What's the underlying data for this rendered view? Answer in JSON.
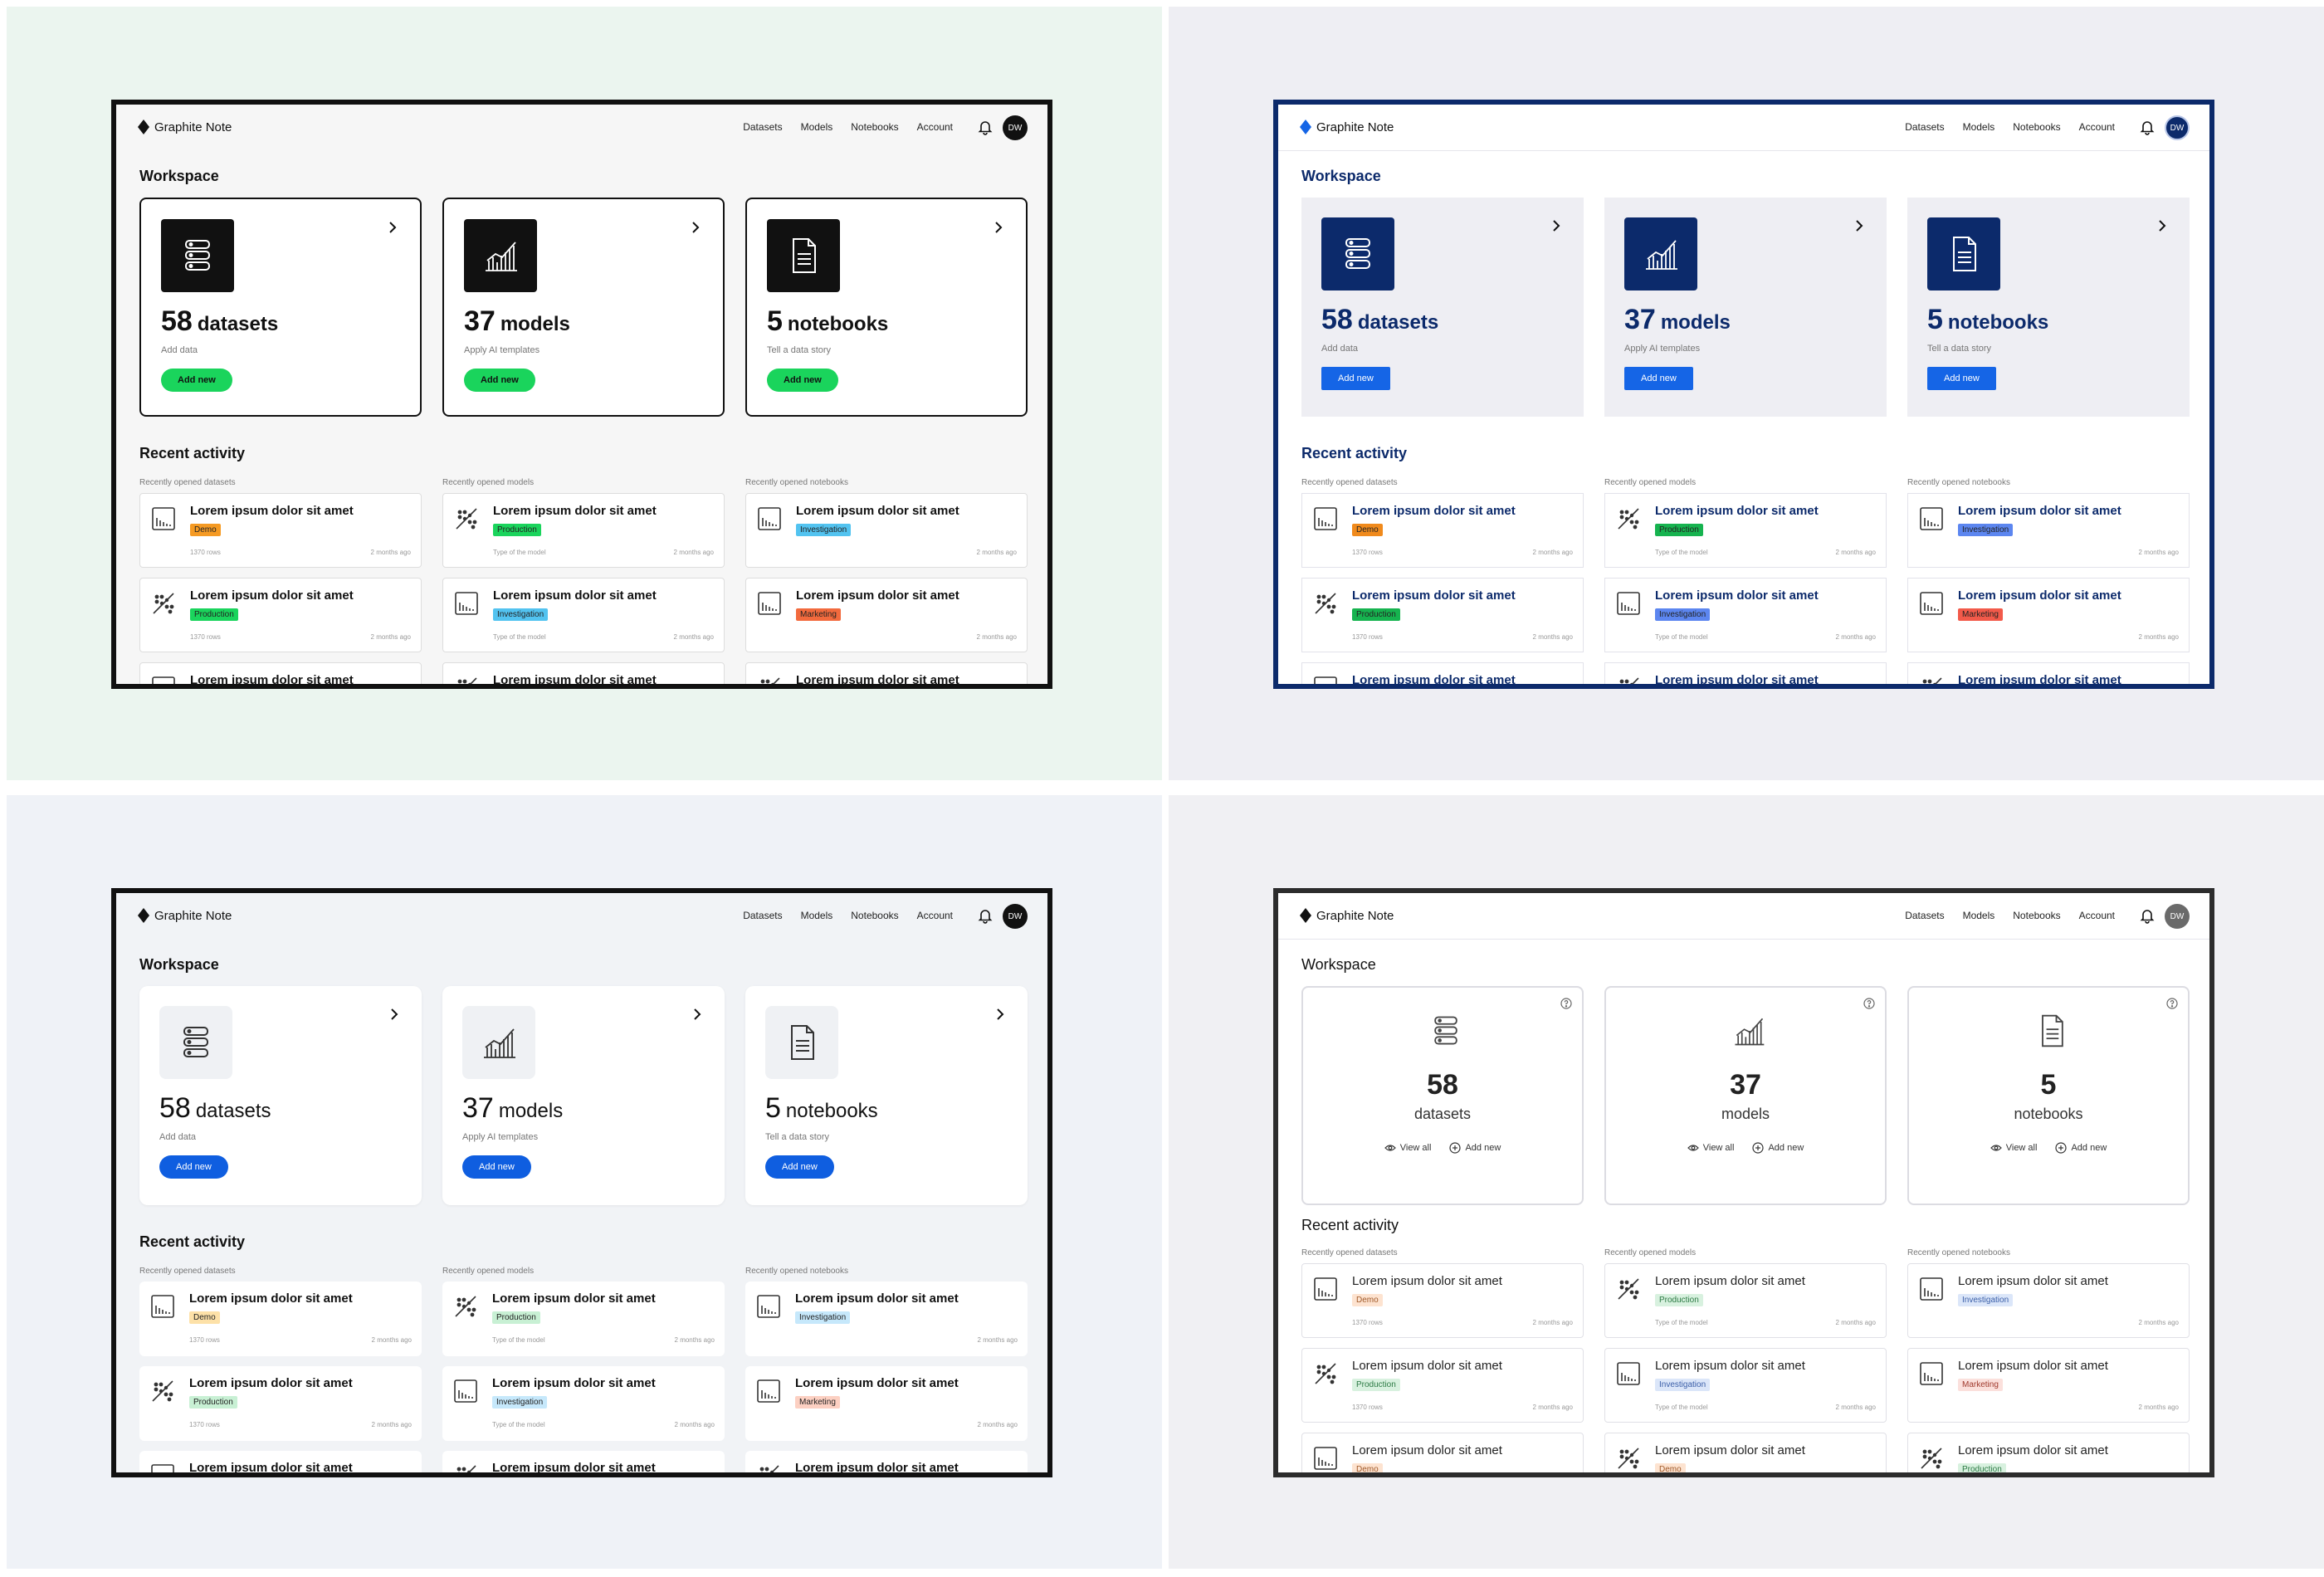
{
  "app": {
    "name": "Graphite Note",
    "avatar": "DW"
  },
  "nav": [
    "Datasets",
    "Models",
    "Notebooks",
    "Account"
  ],
  "workspace": {
    "title": "Workspace",
    "cards": [
      {
        "num": "58",
        "label": "datasets",
        "sub": "Add data",
        "btn": "Add new",
        "icon": "database-icon"
      },
      {
        "num": "37",
        "label": "models",
        "sub": "Apply AI templates",
        "btn": "Add new",
        "icon": "chart-icon"
      },
      {
        "num": "5",
        "label": "notebooks",
        "sub": "Tell a data story",
        "btn": "Add new",
        "icon": "document-icon"
      }
    ],
    "view_all": "View all",
    "add_new": "Add new"
  },
  "recent": {
    "title": "Recent activity",
    "columns": [
      "Recently opened datasets",
      "Recently opened models",
      "Recently opened notebooks"
    ],
    "item_title": "Lorem ipsum dolor sit amet",
    "rows_meta": "1370 rows",
    "model_meta": "Type of the model",
    "time": "2 months ago",
    "badges": {
      "demo": "Demo",
      "prod": "Production",
      "inv": "Investigation",
      "mkt": "Marketing"
    }
  },
  "colors": {
    "green": "#1ad45c",
    "navy": "#0c2a6b",
    "blue": "#1565e6",
    "black": "#111111"
  }
}
